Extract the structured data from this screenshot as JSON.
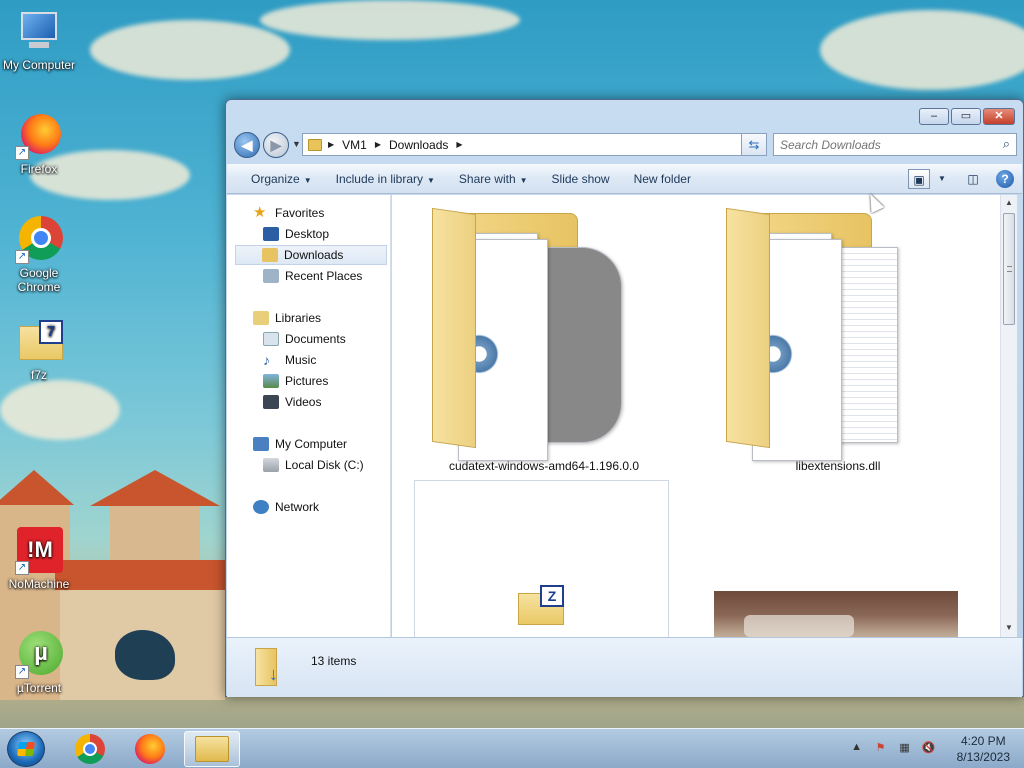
{
  "desktop": {
    "icons": [
      {
        "label": "My Computer"
      },
      {
        "label": "Firefox"
      },
      {
        "label": "Google Chrome"
      },
      {
        "label": "f7z"
      },
      {
        "label": "NoMachine"
      },
      {
        "label": "µTorrent"
      }
    ]
  },
  "window": {
    "address": {
      "crumbs": [
        "VM1",
        "Downloads"
      ]
    },
    "search": {
      "placeholder": "Search Downloads"
    },
    "toolbar": {
      "organize": "Organize",
      "include_in_library": "Include in library",
      "share_with": "Share with",
      "slide_show": "Slide show",
      "new_folder": "New folder"
    },
    "nav": {
      "favorites": "Favorites",
      "desktop": "Desktop",
      "downloads": "Downloads",
      "recent_places": "Recent Places",
      "libraries": "Libraries",
      "documents": "Documents",
      "music": "Music",
      "pictures": "Pictures",
      "videos": "Videos",
      "my_computer": "My Computer",
      "local_disk": "Local Disk (C:)",
      "network": "Network"
    },
    "files": [
      {
        "name": "cudatext-windows-amd64-1.196.0.0"
      },
      {
        "name": "libextensions.dll"
      }
    ],
    "status": {
      "count": "13 items"
    }
  },
  "taskbar": {
    "clock_time": "4:20 PM",
    "clock_date": "8/13/2023"
  },
  "colors": {
    "accent": "#1f5aa6",
    "folder": "#e7c362"
  }
}
